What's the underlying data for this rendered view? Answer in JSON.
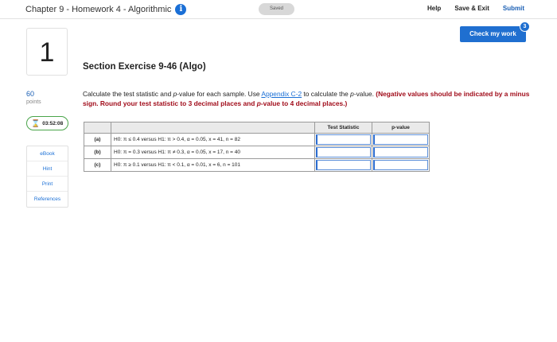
{
  "header": {
    "assignment_title": "Chapter 9 - Homework 4 - Algorithmic",
    "info_icon": "i",
    "saved_label": "Saved",
    "help_label": "Help",
    "save_exit_label": "Save & Exit",
    "submit_label": "Submit"
  },
  "check_work": {
    "label": "Check my work",
    "badge_count": "3"
  },
  "question": {
    "number": "1",
    "points_value": "60",
    "points_label": "points",
    "timer": "03:52:08",
    "side_links": [
      "eBook",
      "Hint",
      "Print",
      "References"
    ],
    "section_title": "Section Exercise 9-46 (Algo)",
    "instr_pre": "Calculate the test statistic and ",
    "instr_pvalue": "p",
    "instr_mid": "-value for each sample. Use ",
    "instr_link": "Appendix C-2",
    "instr_post": " to calculate the ",
    "instr_pvalue2": "p",
    "instr_post2": "-value. ",
    "instr_red": "(Negative values should be indicated by a minus sign. Round your test statistic to 3 decimal places and ",
    "instr_red_p": "p",
    "instr_red_end": "-value to 4 decimal places.)"
  },
  "table": {
    "headers": [
      "",
      "",
      "Test Statistic",
      "p-value"
    ],
    "rows": [
      {
        "label": "(a)",
        "hypothesis": "H0: π ≤ 0.4 versus H1: π > 0.4, α = 0.05, x = 41, n = 82",
        "test_statistic": "",
        "p_value": ""
      },
      {
        "label": "(b)",
        "hypothesis": "H0: π = 0.3 versus H1: π ≠ 0.3, α = 0.05, x = 17, n = 40",
        "test_statistic": "",
        "p_value": ""
      },
      {
        "label": "(c)",
        "hypothesis": "H0: π ≥ 0.1 versus H1: π < 0.1, α = 0.01, x = 6, n = 101",
        "test_statistic": "",
        "p_value": ""
      }
    ]
  }
}
